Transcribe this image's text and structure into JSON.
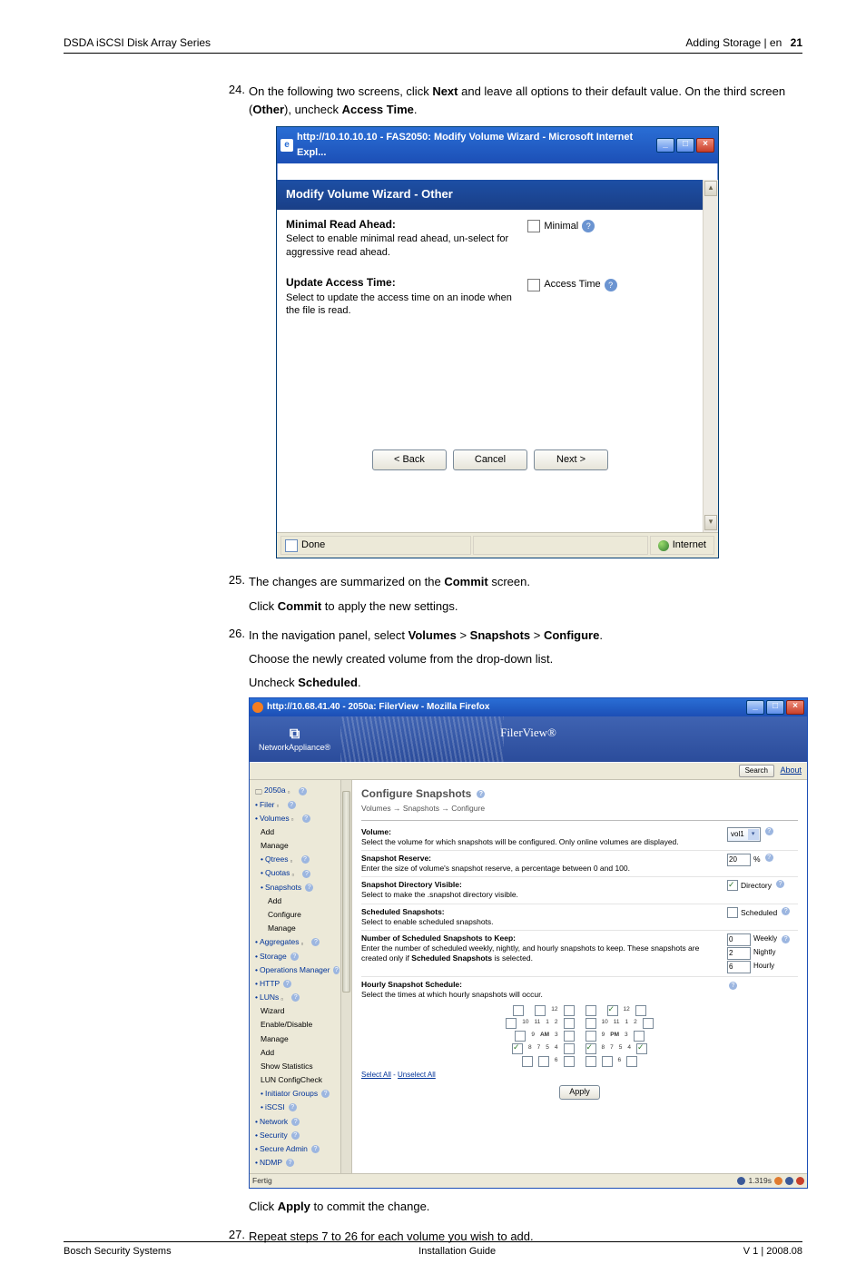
{
  "header": {
    "product": "DSDA iSCSI Disk Array Series",
    "section": "Adding Storage | en",
    "page": "21"
  },
  "steps": {
    "s24": {
      "num": "24.",
      "text1a": "On the following two screens, click ",
      "bold1": "Next",
      "text1b": " and leave all options to their default value. On the third screen (",
      "bold2": "Other",
      "text1c": "), uncheck ",
      "bold3": "Access Time",
      "text1d": "."
    },
    "s25": {
      "num": "25.",
      "line1a": "The changes are summarized on the ",
      "bold1": "Commit",
      "line1b": " screen.",
      "line2a": "Click ",
      "bold2": "Commit",
      "line2b": " to apply the new settings."
    },
    "s26": {
      "num": "26.",
      "line1a": "In the navigation panel, select ",
      "b1": "Volumes",
      "sep": " > ",
      "b2": "Snapshots",
      "b3": "Configure",
      "line1end": ".",
      "line2": "Choose the newly created volume from the drop-down list.",
      "line3a": "Uncheck ",
      "b4": "Scheduled",
      "line3end": ".",
      "after_a": "Click ",
      "after_b": "Apply",
      "after_c": " to commit the change."
    },
    "s27": {
      "num": "27.",
      "text": "Repeat steps 7 to 26 for each volume you wish to add."
    }
  },
  "ie": {
    "title": "http://10.10.10.10 - FAS2050: Modify Volume Wizard - Microsoft Internet Expl...",
    "win_min": "_",
    "win_max": "□",
    "win_close": "×",
    "dialog_title": "Modify Volume Wizard - Other",
    "row1_title": "Minimal Read Ahead:",
    "row1_desc": "Select to enable minimal read ahead, un-select for aggressive read ahead.",
    "row1_check_label": "Minimal",
    "row2_title": "Update Access Time:",
    "row2_desc": "Select to update the access time on an inode when the file is read.",
    "row2_check_label": "Access Time",
    "btn_back": "< Back",
    "btn_cancel": "Cancel",
    "btn_next": "Next >",
    "status_done": "Done",
    "status_zone": "Internet"
  },
  "ff": {
    "title": "http://10.68.41.40 - 2050a: FilerView - Mozilla Firefox",
    "brand_symbol": "⧉",
    "brand_name": "NetworkAppliance®",
    "filerview": "FilerView®",
    "search": "Search",
    "about": "About",
    "nav": {
      "top": "2050a",
      "filer": "Filer",
      "volumes": "Volumes",
      "volumes_add": "Add",
      "volumes_manage": "Manage",
      "qtrees": "Qtrees",
      "quotas": "Quotas",
      "snapshots": "Snapshots",
      "snap_add": "Add",
      "snap_configure": "Configure",
      "snap_manage": "Manage",
      "aggregates": "Aggregates",
      "storage": "Storage",
      "ops_mgr": "Operations Manager",
      "http": "HTTP",
      "luns": "LUNs",
      "luns_wizard": "Wizard",
      "luns_enable": "Enable/Disable",
      "luns_manage": "Manage",
      "luns_add": "Add",
      "luns_stats": "Show Statistics",
      "luns_config": "LUN ConfigCheck",
      "initiator": "Initiator Groups",
      "iscsi": "iSCSI",
      "network": "Network",
      "security": "Security",
      "secure_admin": "Secure Admin",
      "ndmp": "NDMP"
    },
    "content": {
      "h2": "Configure Snapshots",
      "breadcrumb": "Volumes → Snapshots → Configure",
      "volume": {
        "label": "Volume:",
        "desc": "Select the volume for which snapshots will be configured. Only online volumes are displayed.",
        "value": "vol1"
      },
      "reserve": {
        "label": "Snapshot Reserve:",
        "desc": "Enter the size of volume's snapshot reserve, a percentage between 0 and 100.",
        "value": "20",
        "pct": "%"
      },
      "dirvis": {
        "label": "Snapshot Directory Visible:",
        "desc": "Select to make the .snapshot directory visible.",
        "check_label": "Directory"
      },
      "sched": {
        "label": "Scheduled Snapshots:",
        "desc": "Select to enable scheduled snapshots.",
        "check_label": "Scheduled"
      },
      "keep": {
        "label": "Number of Scheduled Snapshots to Keep:",
        "desc_a": "Enter the number of scheduled weekly, nightly, and hourly snapshots to keep. These snapshots are created only if ",
        "desc_bold": "Scheduled Snapshots",
        "desc_b": " is selected.",
        "weekly": "Weekly",
        "weekly_v": "0",
        "nightly": "Nightly",
        "nightly_v": "2",
        "hourly": "Hourly",
        "hourly_v": "6"
      },
      "hourly": {
        "label": "Hourly Snapshot Schedule:",
        "desc": "Select the times at which hourly snapshots will occur.",
        "am": "AM",
        "pm": "PM",
        "t10": "10",
        "t11": "11",
        "t12": "12",
        "t1": "1",
        "t2": "2",
        "t3": "3",
        "t4": "4",
        "t5": "5",
        "t6": "6",
        "t7": "7",
        "t8": "8",
        "t9": "9",
        "select_all": "Select All",
        "unselect_all": "Unselect All",
        "apply": "Apply"
      }
    },
    "status_left": "Fertig",
    "status_right": "1.319s"
  },
  "footer": {
    "left": "Bosch Security Systems",
    "center": "Installation Guide",
    "right": "V 1 | 2008.08"
  }
}
